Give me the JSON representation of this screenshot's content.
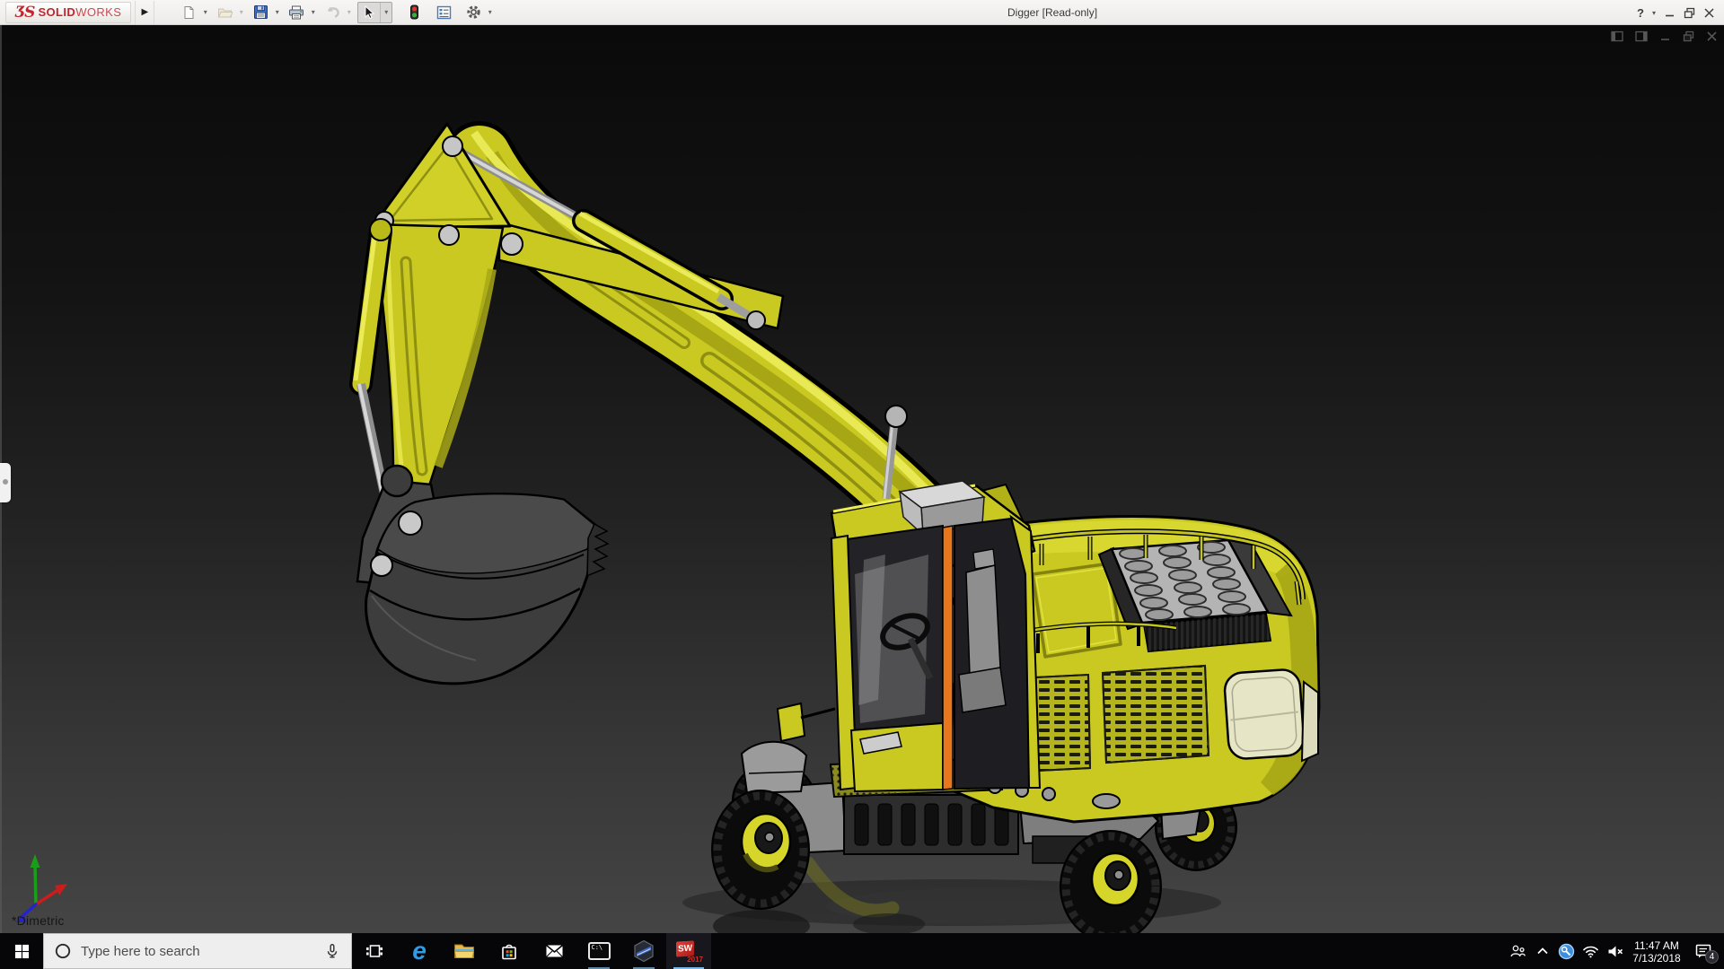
{
  "app": {
    "brand_mark": "ƷS",
    "brand_solid": "SOLID",
    "brand_works": "WORKS",
    "flyout_arrow": "▶",
    "title": "Digger [Read-only]",
    "help_glyph": "?",
    "caret": "▾"
  },
  "toolbar": {
    "buttons": [
      "new-document",
      "open",
      "save",
      "print",
      "undo",
      "select",
      "rebuild-traffic-light",
      "file-properties",
      "options-gear"
    ]
  },
  "viewport": {
    "orientation_label": "*Dimetric",
    "bg_top": "#0a0a0a",
    "bg_bottom": "#454545",
    "model_yellow": "#c9c922",
    "triad_colors": {
      "x": "#cc1d1d",
      "y": "#1a9e1a",
      "z": "#2424c8"
    }
  },
  "taskbar": {
    "search": {
      "placeholder": "Type here to search"
    },
    "apps": [
      "task-view",
      "edge",
      "file-explorer",
      "store",
      "mail",
      "command-prompt",
      "hexagon-app",
      "solidworks-2017"
    ],
    "edge_glyph": "e",
    "cmd_glyph": "C:\\",
    "sw_label": "SW",
    "sw_year": "2017",
    "tray": {
      "time": "11:47 AM",
      "date": "7/13/2018",
      "notifications": "4"
    }
  }
}
